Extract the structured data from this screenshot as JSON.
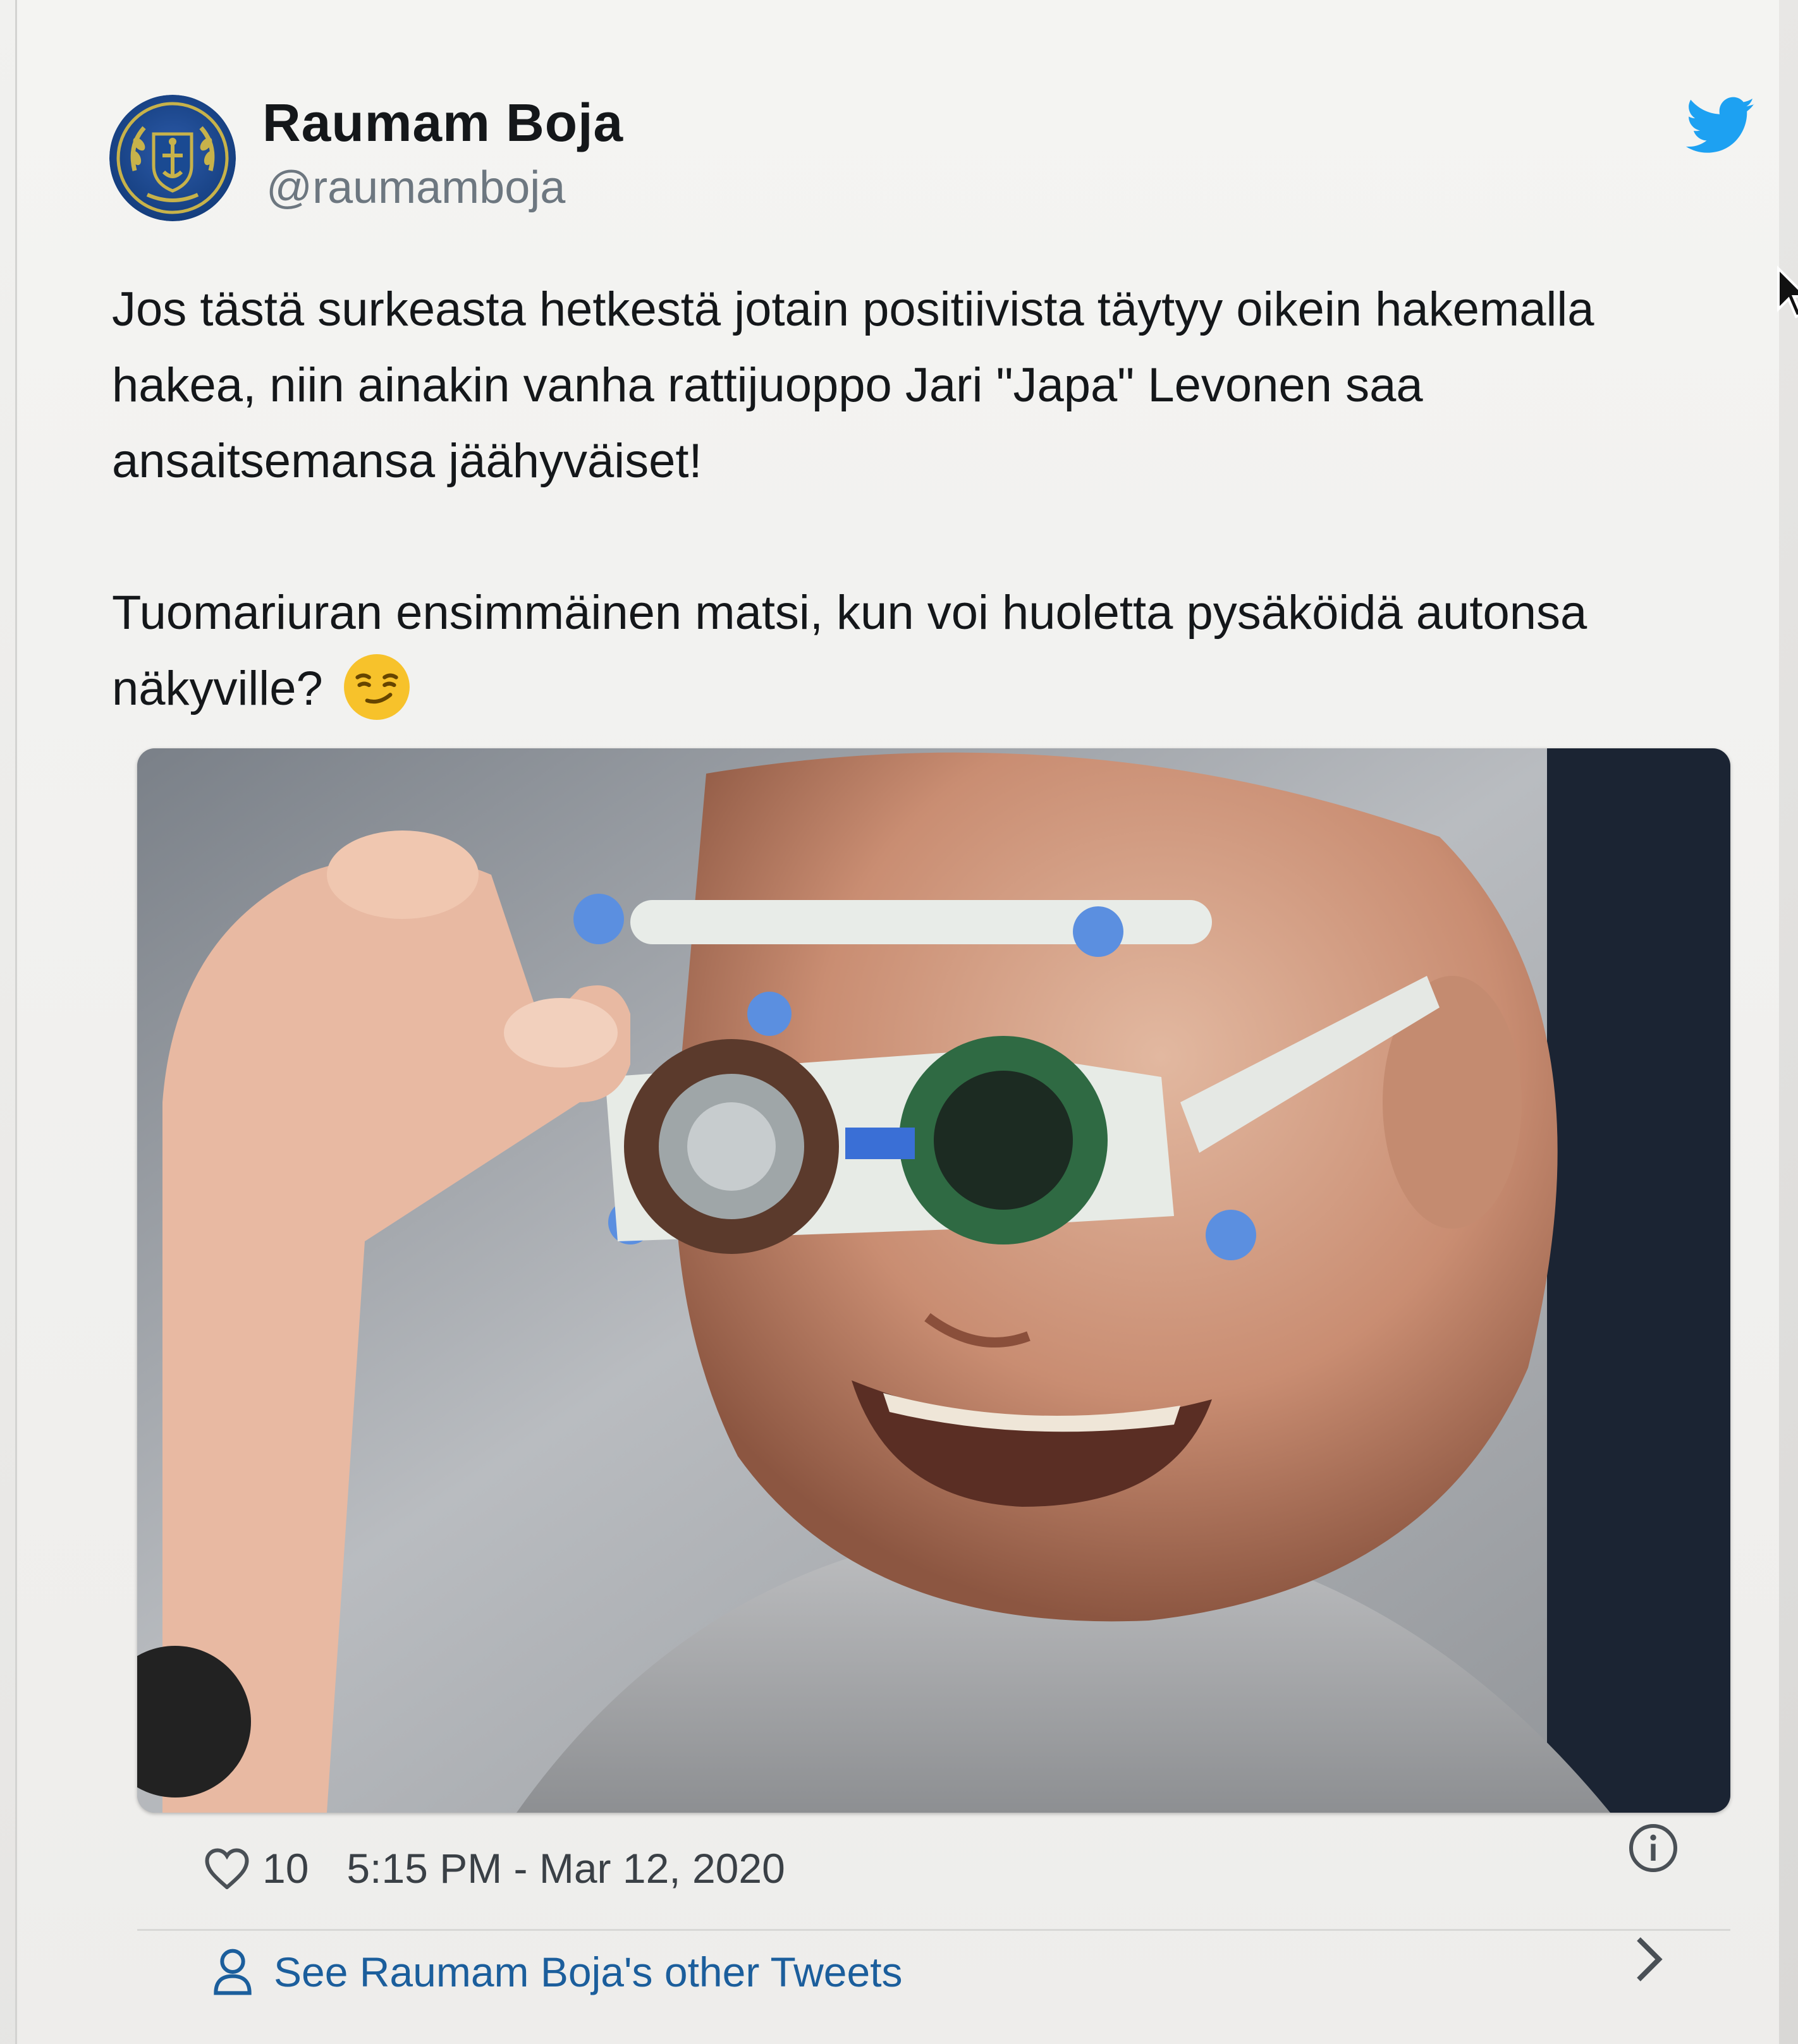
{
  "author": {
    "name": "Raumam Boja",
    "handle": "@raumamboja",
    "avatar_icon": "club-crest-icon"
  },
  "tweet": {
    "paragraph_1": "Jos tästä surkeasta hetkestä jotain positiivista täytyy oikein hakemalla hakea, niin ainakin vanha rattijuoppo Jari \"Japa\" Levonen saa ansaitsemansa jäähyväiset!",
    "paragraph_2": "Tuomariuran ensimmäinen matsi, kun voi huoletta pysäköidä autonsa näkyville?",
    "emoji_icon": "smirking-face-emoji"
  },
  "footer": {
    "likes": "10",
    "timestamp": "5:15 PM - Mar 12, 2020",
    "heart_icon": "heart-icon",
    "info_icon": "info-icon"
  },
  "other_tweets": {
    "label": "See Raumam Boja's other Tweets",
    "icon": "person-icon"
  },
  "colors": {
    "twitter_blue": "#1da1f2",
    "link_blue": "#1b5e9c",
    "text": "#14171a",
    "secondary_text": "#6d7780"
  }
}
